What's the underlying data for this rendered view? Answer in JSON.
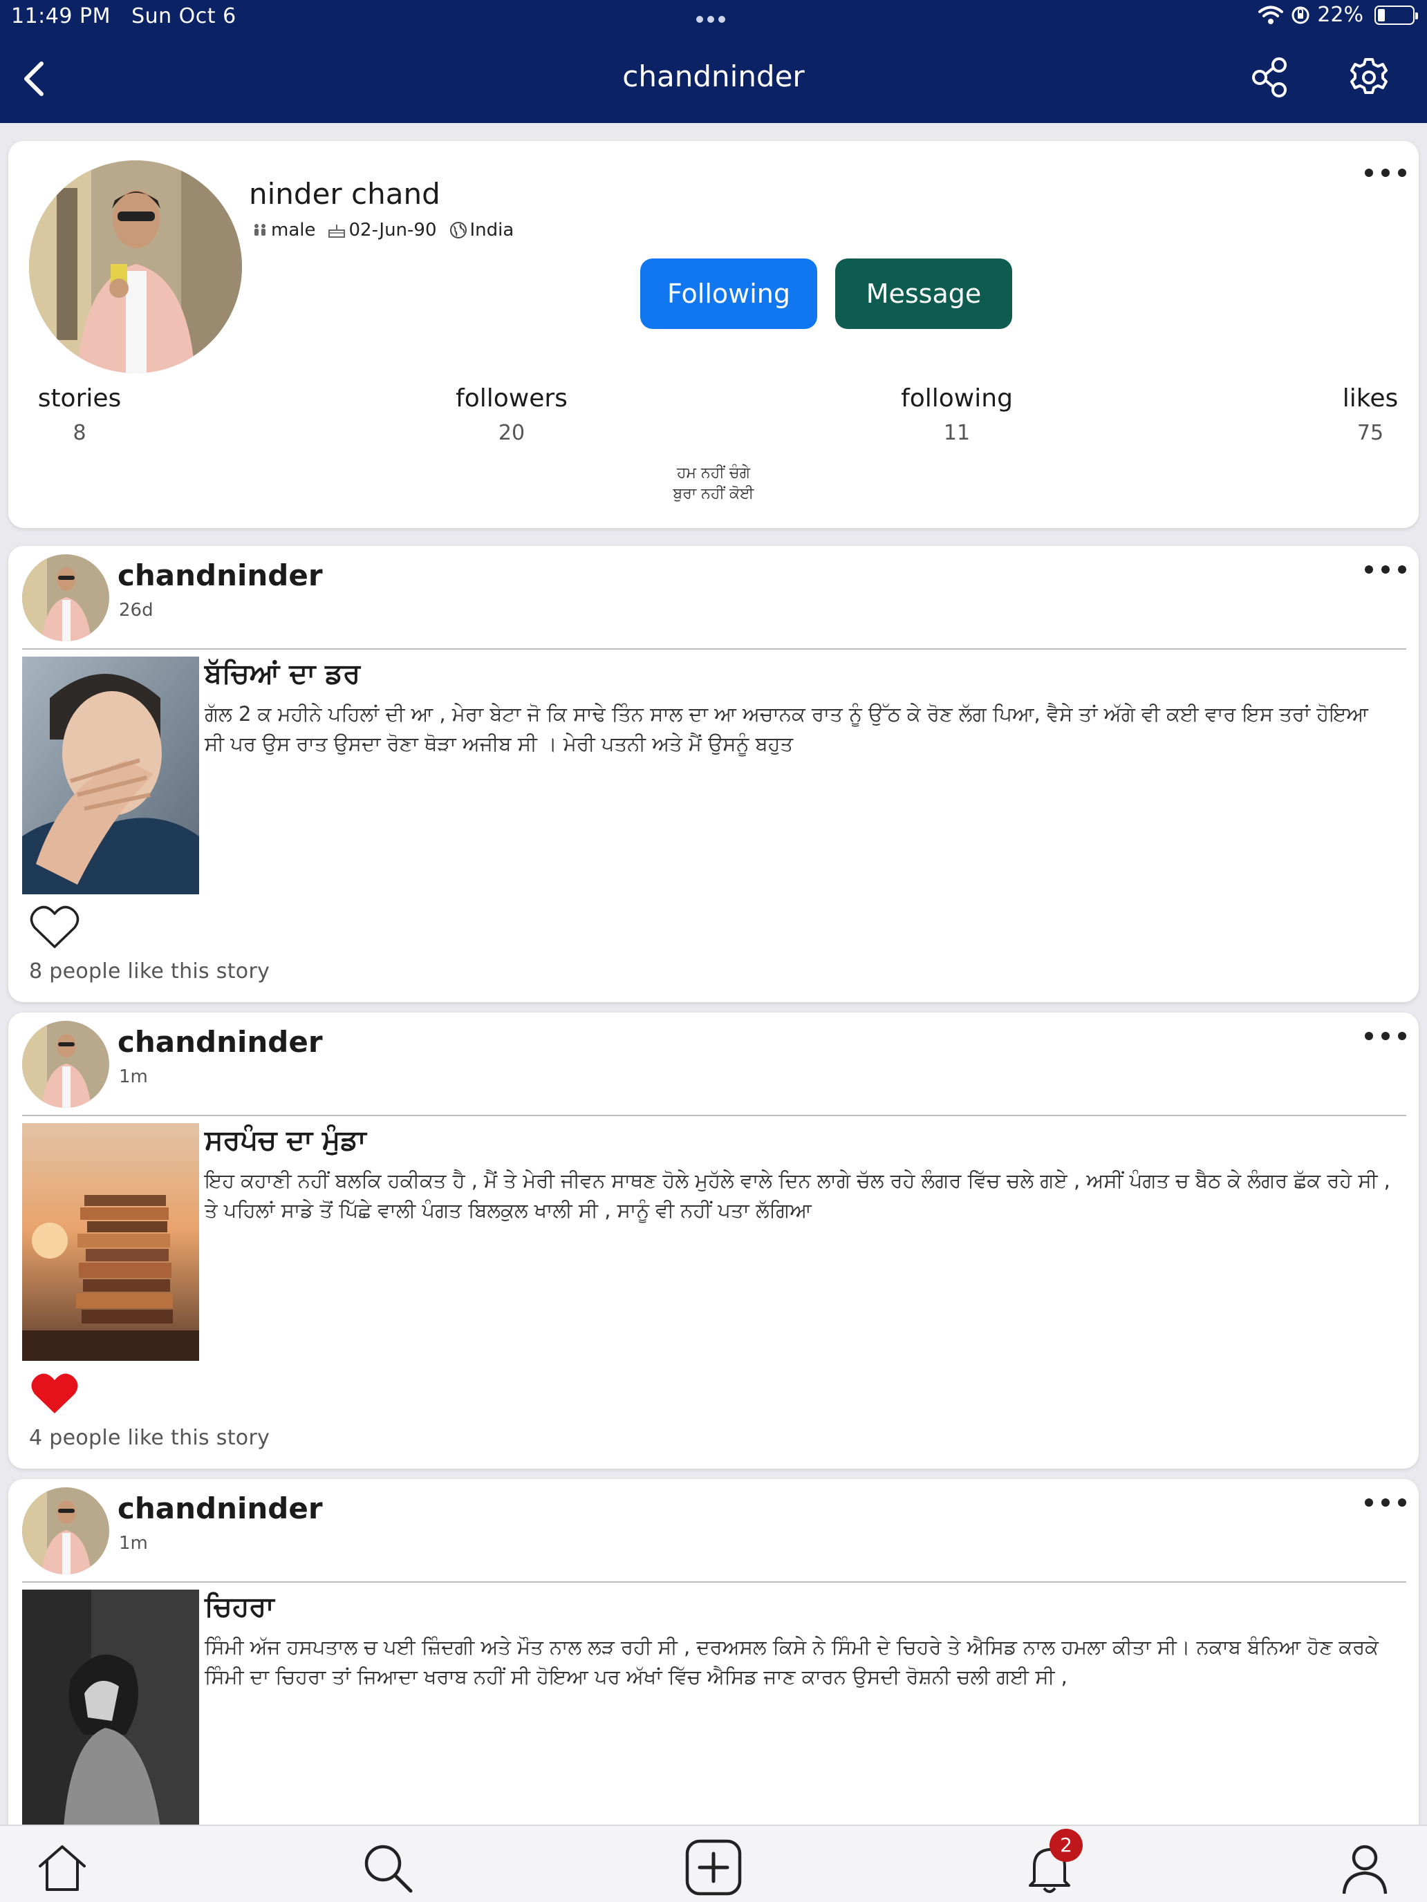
{
  "status_bar": {
    "time": "11:49 PM",
    "date": "Sun Oct 6",
    "battery": "22%"
  },
  "nav": {
    "title": "chandninder",
    "back_icon": "chevron-left-icon",
    "share_icon": "share-icon",
    "settings_icon": "gear-icon"
  },
  "colors": {
    "navy": "#0b2265",
    "follow_blue": "#1077f0",
    "message_green": "#0d5c4f",
    "like_red": "#e5121b",
    "badge_red": "#c0171c"
  },
  "profile": {
    "name": "ninder chand",
    "gender": "male",
    "birthday": "02-Jun-90",
    "country": "India",
    "follow_label": "Following",
    "message_label": "Message",
    "stats": [
      {
        "label": "stories",
        "value": "8"
      },
      {
        "label": "followers",
        "value": "20"
      },
      {
        "label": "following",
        "value": "11"
      },
      {
        "label": "likes",
        "value": "75"
      }
    ],
    "bio_line1": "ਹਮ ਨਹੀਂ ਚੰਗੇ",
    "bio_line2": "ਬੁਰਾ ਨਹੀਂ ਕੋਈ"
  },
  "stories": [
    {
      "author": "chandninder",
      "age": "26d",
      "title": "ਬੱਚਿਆਂ ਦਾ ਡਰ",
      "excerpt": "ਗੱਲ 2 ਕ ਮਹੀਨੇ ਪਹਿਲਾਂ ਦੀ ਆ , ਮੇਰਾ ਬੇਟਾ ਜੋ ਕਿ ਸਾਢੇ ਤਿੰਨ ਸਾਲ ਦਾ ਆ ਅਚਾਨਕ ਰਾਤ ਨੂੰ ਉੱਠ ਕੇ ਰੋਣ ਲੱਗ ਪਿਆ, ਵੈਸੇ ਤਾਂ ਅੱਗੇ ਵੀ ਕਈ ਵਾਰ ਇਸ ਤਰਾਂ ਹੋਇਆ ਸੀ ਪਰ ਉਸ ਰਾਤ ਉਸਦਾ ਰੋਣਾ ਥੋੜਾ ਅਜੀਬ ਸੀ । ਮੇਰੀ ਪਤਨੀ ਅਤੇ ਮੈਂ ਉਸਨੂੰ ਬਹੁਤ",
      "liked": false,
      "likes_text": "8 people like this story"
    },
    {
      "author": "chandninder",
      "age": "1m",
      "title": "ਸਰਪੰਚ ਦਾ ਮੁੰਡਾ",
      "excerpt": "ਇਹ ਕਹਾਣੀ ਨਹੀਂ ਬਲਕਿ ਹਕੀਕਤ ਹੈ , ਮੈਂ ਤੇ ਮੇਰੀ ਜੀਵਨ ਸਾਥਣ ਹੋਲੇ ਮੁਹੱਲੇ ਵਾਲੇ ਦਿਨ ਲਾਗੇ ਚੱਲ ਰਹੇ ਲੰਗਰ ਵਿੱਚ ਚਲੇ ਗਏ , ਅਸੀਂ ਪੰਗਤ ਚ ਬੈਠ ਕੇ ਲੰਗਰ ਛੱਕ ਰਹੇ ਸੀ , ਤੇ ਪਹਿਲਾਂ ਸਾਡੇ ਤੋਂ ਪਿੱਛੇ ਵਾਲੀ ਪੰਗਤ ਬਿਲਕੁਲ ਖਾਲੀ ਸੀ , ਸਾਨੂੰ ਵੀ ਨਹੀਂ ਪਤਾ ਲੱਗਿਆ",
      "liked": true,
      "likes_text": "4 people like this story"
    },
    {
      "author": "chandninder",
      "age": "1m",
      "title": "ਚਿਹਰਾ",
      "excerpt": "ਸਿੰਮੀ ਅੱਜ ਹਸਪਤਾਲ ਚ ਪਈ ਜ਼ਿੰਦਗੀ ਅਤੇ ਮੌਤ ਨਾਲ ਲੜ ਰਹੀ ਸੀ , ਦਰਅਸਲ ਕਿਸੇ ਨੇ ਸਿੰਮੀ ਦੇ ਚਿਹਰੇ ਤੇ ਐਸਿਡ ਨਾਲ ਹਮਲਾ ਕੀਤਾ ਸੀ। ਨਕਾਬ ਬੰਨਿਆ ਹੋਣ ਕਰਕੇ ਸਿੰਮੀ ਦਾ ਚਿਹਰਾ ਤਾਂ ਜਿਆਦਾ ਖਰਾਬ ਨਹੀਂ ਸੀ ਹੋਇਆ ਪਰ ਅੱਖਾਂ ਵਿੱਚ ਐਸਿਡ ਜਾਣ ਕਾਰਨ ਉਸਦੀ ਰੋਸ਼ਨੀ ਚਲੀ ਗਈ ਸੀ ,"
    }
  ],
  "tabbar": {
    "items": [
      "home-icon",
      "search-icon",
      "add-story-icon",
      "notifications-icon",
      "profile-icon"
    ],
    "notification_count": "2"
  }
}
